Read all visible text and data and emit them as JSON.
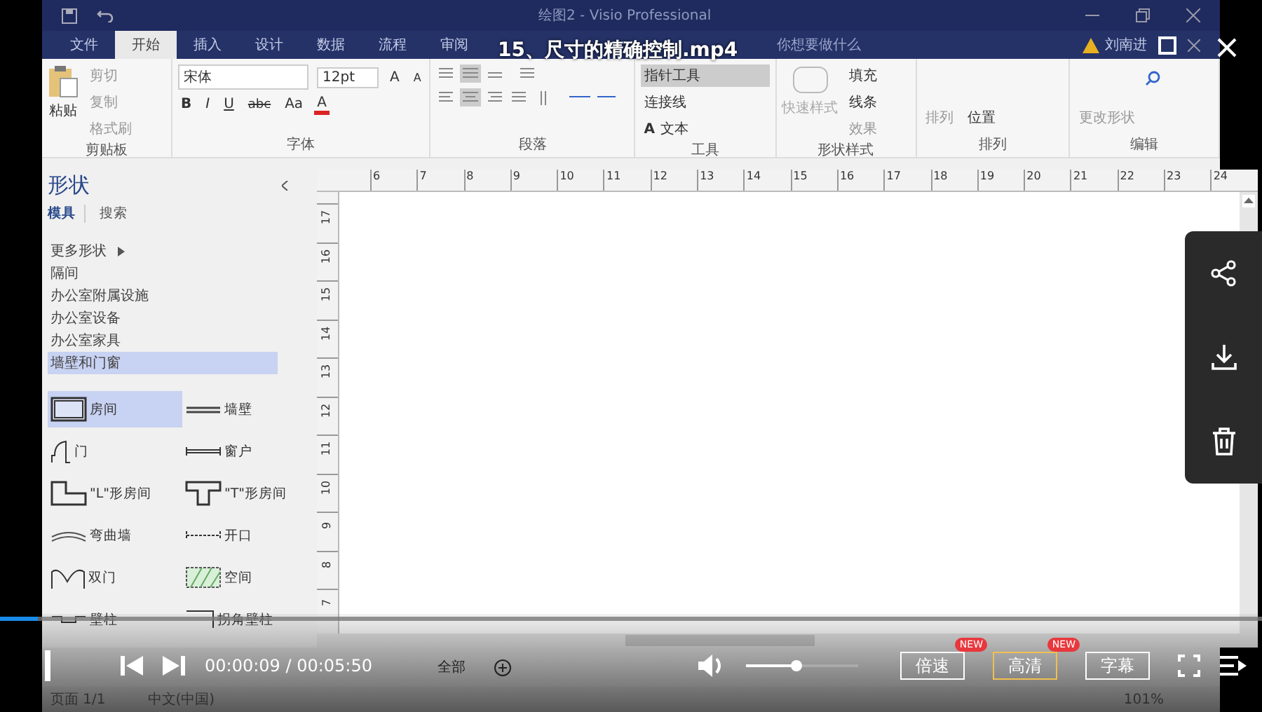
{
  "player": {
    "title": "15、尺寸的精确控制.mp4",
    "progress": {
      "level": 0.03
    },
    "time": "00:00:09 / 00:05:50",
    "volume": {
      "level": 0.45
    },
    "buttons": [
      {
        "label": "倍速",
        "badge": "NEW",
        "selected": false
      },
      {
        "label": "高清",
        "badge": "NEW",
        "selected": true
      },
      {
        "label": "字幕",
        "selected": false
      }
    ]
  },
  "visio": {
    "window_title": "绘图2 - Visio Professional",
    "tabs": [
      {
        "label": "文件",
        "selected": false
      },
      {
        "label": "开始",
        "selected": true
      },
      {
        "label": "插入",
        "selected": false
      },
      {
        "label": "设计",
        "selected": false
      },
      {
        "label": "数据",
        "selected": false
      },
      {
        "label": "流程",
        "selected": false
      },
      {
        "label": "审阅",
        "selected": false
      }
    ],
    "tell_me": "你想要做什么",
    "user": "刘南进",
    "ribbon": {
      "clipboard": {
        "label": "剪贴板",
        "paste": "粘贴",
        "items": [
          "剪切",
          "复制",
          "格式刷"
        ]
      },
      "font": {
        "label": "字体",
        "family": "宋体",
        "size": "12pt",
        "resize": [
          "A",
          "A"
        ],
        "format": [
          "B",
          "I",
          "U",
          "abc",
          "Aa"
        ],
        "color_letter": "A"
      },
      "paragraph": {
        "label": "段落"
      },
      "tools": {
        "label": "工具",
        "items": [
          {
            "label": "指针工具",
            "selected": true
          },
          {
            "label": "连接线",
            "selected": false
          },
          {
            "label": "文本",
            "glyph": "A",
            "selected": false
          }
        ]
      },
      "shape_styles": {
        "label": "形状样式",
        "quick": {
          "label": "快速样式",
          "disabled": true
        },
        "items": [
          {
            "label": "填充",
            "disabled": false
          },
          {
            "label": "线条",
            "disabled": false
          },
          {
            "label": "效果",
            "disabled": true
          }
        ]
      },
      "arrange": {
        "label": "排列",
        "items": [
          {
            "label": "排列",
            "disabled": true
          },
          {
            "label": "位置",
            "disabled": false
          }
        ]
      },
      "editing": {
        "label": "编辑",
        "items": [
          {
            "label": "更改形状",
            "disabled": true
          }
        ]
      }
    },
    "shapes_panel": {
      "title": "形状",
      "tabs": [
        {
          "label": "模具",
          "selected": true
        },
        {
          "label": "搜索",
          "selected": false
        }
      ],
      "stencils": [
        {
          "label": "更多形状",
          "kind": "menu",
          "selected": false
        },
        {
          "label": "隔间",
          "kind": "stencil",
          "selected": false
        },
        {
          "label": "办公室附属设施",
          "kind": "stencil",
          "selected": false
        },
        {
          "label": "办公室设备",
          "kind": "stencil",
          "selected": false
        },
        {
          "label": "办公室家具",
          "kind": "stencil",
          "selected": false
        },
        {
          "label": "墙壁和门窗",
          "kind": "stencil",
          "selected": true
        }
      ],
      "shapes": [
        {
          "label": "房间",
          "kind": "room",
          "selected": true
        },
        {
          "label": "墙壁",
          "kind": "wall",
          "selected": false
        },
        {
          "label": "门",
          "kind": "door",
          "selected": false
        },
        {
          "label": "窗户",
          "kind": "window",
          "selected": false
        },
        {
          "label": "\"L\"形房间",
          "kind": "l-room",
          "selected": false
        },
        {
          "label": "\"T\"形房间",
          "kind": "t-room",
          "selected": false
        },
        {
          "label": "弯曲墙",
          "kind": "curved-wall",
          "selected": false
        },
        {
          "label": "开口",
          "kind": "opening",
          "selected": false
        },
        {
          "label": "双门",
          "kind": "double-door",
          "selected": false
        },
        {
          "label": "空间",
          "kind": "space",
          "selected": false
        },
        {
          "label": "壁柱",
          "kind": "pilaster",
          "selected": false
        },
        {
          "label": "拐角壁柱",
          "kind": "corner-pilaster",
          "selected": false
        }
      ]
    },
    "ruler": {
      "horizontal": [
        "6",
        "7",
        "8",
        "9",
        "10",
        "11",
        "12",
        "13",
        "14",
        "15",
        "16",
        "17",
        "18",
        "19",
        "20",
        "21",
        "22",
        "23",
        "24"
      ],
      "vertical": [
        "17",
        "16",
        "15",
        "14",
        "13",
        "12",
        "11",
        "10",
        "9",
        "8",
        "7"
      ]
    },
    "sheet_tabs": {
      "all": "全部"
    },
    "status_bar": {
      "page": "页面 1/1",
      "language": "中文(中国)",
      "zoom": "101%"
    }
  }
}
